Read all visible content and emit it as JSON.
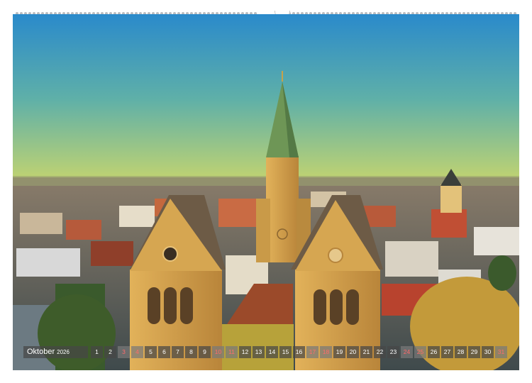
{
  "calendar": {
    "month": "Oktober",
    "year": "2026",
    "days": [
      "1",
      "2",
      "3",
      "4",
      "5",
      "6",
      "7",
      "8",
      "9",
      "10",
      "11",
      "12",
      "13",
      "14",
      "15",
      "16",
      "17",
      "18",
      "19",
      "20",
      "21",
      "22",
      "23",
      "24",
      "25",
      "26",
      "27",
      "28",
      "29",
      "30",
      "31"
    ],
    "weekend_days": [
      "3",
      "4",
      "10",
      "11",
      "17",
      "18",
      "24",
      "25",
      "31"
    ]
  },
  "colors": {
    "sky_top": "#2f8fcf",
    "sky_horizon": "#c9d670",
    "stone": "#d2a04a",
    "roof": "#7e6a52",
    "spire": "#6f9a5a",
    "weekend_text": "#ff6b6b"
  }
}
